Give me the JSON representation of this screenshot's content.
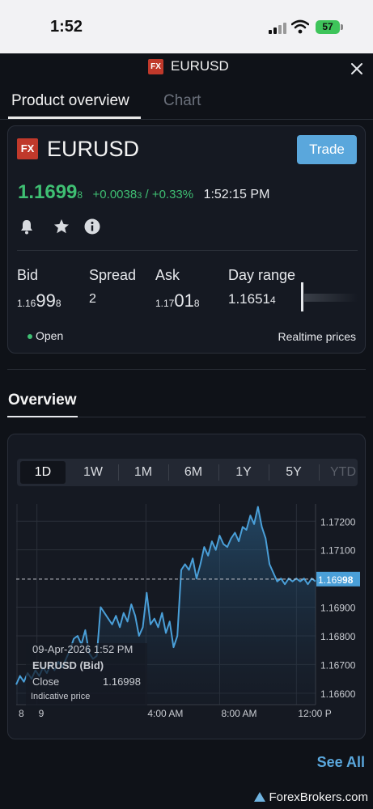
{
  "status_bar": {
    "time": "1:52",
    "battery": "57"
  },
  "header": {
    "badge": "FX",
    "title": "EURUSD"
  },
  "tabs": [
    {
      "label": "Product overview"
    },
    {
      "label": "Chart"
    }
  ],
  "product": {
    "badge": "FX",
    "symbol": "EURUSD",
    "trade_label": "Trade",
    "price_main": "1.1699",
    "price_sub": "8",
    "change_main": "+0.0038",
    "change_sub": "3",
    "change_pct": " / +0.33%",
    "time": "1:52:15 PM",
    "icons": [
      "bell-icon",
      "star-icon",
      "info-icon"
    ]
  },
  "quote": {
    "bid_label": "Bid",
    "bid_pre": "1.16",
    "bid_big": "99",
    "bid_post": "8",
    "spread_label": "Spread",
    "spread_value": "2",
    "ask_label": "Ask",
    "ask_pre": "1.17",
    "ask_big": "01",
    "ask_post": "8",
    "range_label": "Day range",
    "range_pre": "1.1651",
    "range_post": "4"
  },
  "market_status": "Open",
  "realtime_label": "Realtime prices",
  "overview_title": "Overview",
  "periods": [
    "1D",
    "1W",
    "1M",
    "6M",
    "1Y",
    "5Y",
    "YTD"
  ],
  "active_period": "1D",
  "chart_data": {
    "type": "area",
    "series": [
      {
        "name": "EURUSD (Bid)",
        "x_hours": [
          0,
          0.5,
          1,
          1.5,
          2,
          2.5,
          3,
          3.5,
          4,
          4.5,
          5,
          5.5,
          6,
          6.5,
          7,
          7.5,
          8,
          8.5,
          9,
          9.5,
          10,
          10.5,
          11,
          11.5,
          12,
          12.5,
          13,
          13.5,
          14,
          14.5,
          15,
          15.5,
          16,
          16.5,
          17,
          17.5,
          18,
          18.5,
          19,
          19.5,
          20,
          20.5,
          21,
          21.5,
          22,
          22.5,
          23,
          23.5,
          24,
          24.5,
          25,
          25.5,
          26,
          26.5,
          27,
          27.5,
          28,
          28.5,
          29,
          29.5,
          30,
          30.5,
          31,
          31.5,
          32,
          32.5,
          33,
          33.5,
          34,
          34.5,
          35,
          35.5,
          36,
          36.5,
          37,
          37.5,
          38,
          38.5,
          39
        ],
        "values": [
          1.1663,
          1.1666,
          1.1664,
          1.1667,
          1.1665,
          1.1668,
          1.1666,
          1.1669,
          1.1667,
          1.167,
          1.1668,
          1.1671,
          1.1669,
          1.1672,
          1.1675,
          1.1679,
          1.168,
          1.1677,
          1.1682,
          1.1674,
          1.1672,
          1.1673,
          1.169,
          1.1688,
          1.1686,
          1.1684,
          1.1687,
          1.1683,
          1.1688,
          1.1685,
          1.1691,
          1.1687,
          1.168,
          1.1683,
          1.1695,
          1.1684,
          1.1686,
          1.1683,
          1.1688,
          1.1681,
          1.1685,
          1.1676,
          1.168,
          1.1703,
          1.1705,
          1.1703,
          1.1707,
          1.17,
          1.1705,
          1.1711,
          1.1708,
          1.1713,
          1.171,
          1.1715,
          1.1712,
          1.1711,
          1.1714,
          1.1716,
          1.1713,
          1.1718,
          1.1717,
          1.1722,
          1.1719,
          1.1725,
          1.1718,
          1.1714,
          1.1705,
          1.1702,
          1.1699,
          1.17,
          1.1698,
          1.17,
          1.1699,
          1.17,
          1.1699,
          1.17,
          1.1698,
          1.17,
          1.1699
        ]
      }
    ],
    "current_value": 1.16998,
    "current_label_a": "1.169",
    "current_label_b": "98",
    "y_ticks": [
      1.172,
      1.171,
      1.169,
      1.168,
      1.167,
      1.166
    ],
    "y_tick_labels": [
      "1.17200",
      "1.17100",
      "1.16900",
      "1.16800",
      "1.16700",
      "1.16600"
    ],
    "x_ticks": [
      0,
      2.6,
      16.8,
      26.4,
      36.4
    ],
    "x_tick_labels": [
      "8",
      "9",
      "4:00 AM",
      "8:00 AM",
      "12:00 P"
    ],
    "ylim": [
      1.1656,
      1.1726
    ],
    "xlim": [
      0,
      39
    ],
    "grid": true
  },
  "tooltip": {
    "date": "09-Apr-2026 1:52 PM",
    "series": "EURUSD (Bid)",
    "close_label": "Close",
    "close_value": "1.16998",
    "note": "Indicative price"
  },
  "see_all": "See All",
  "watermark": "ForexBrokers.com",
  "colors": {
    "accent": "#5aa7dc",
    "positive": "#3fbf73",
    "fx_badge": "#c0392b",
    "line": "#4a9fd8"
  }
}
